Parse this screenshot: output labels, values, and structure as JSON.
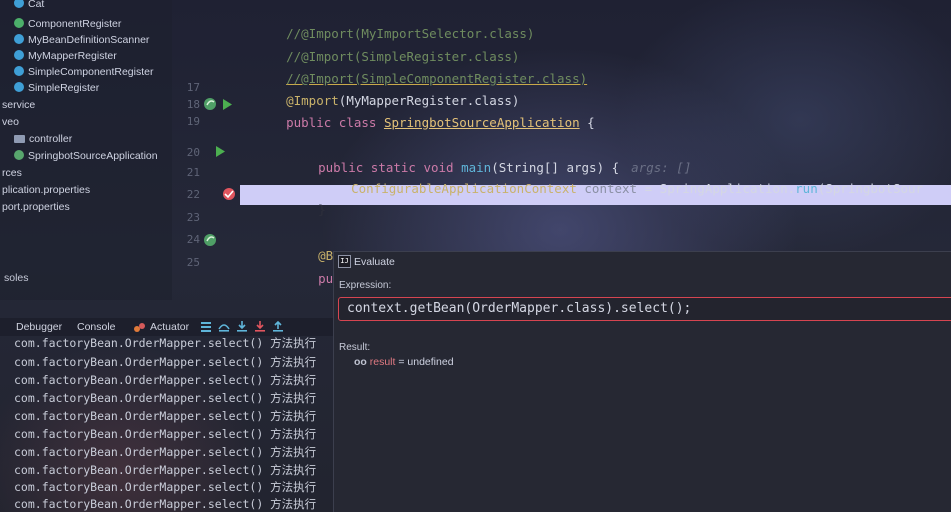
{
  "project_tree": {
    "items": [
      {
        "label": "Cat",
        "icon": "class-icon"
      },
      {
        "label": "ComponentRegister",
        "icon": "annotation-icon"
      },
      {
        "label": "MyBeanDefinitionScanner",
        "icon": "class-icon"
      },
      {
        "label": "MyMapperRegister",
        "icon": "class-icon"
      },
      {
        "label": "SimpleComponentRegister",
        "icon": "class-icon"
      },
      {
        "label": "SimpleRegister",
        "icon": "class-icon"
      },
      {
        "label": "service",
        "icon": ""
      },
      {
        "label": "veo",
        "icon": ""
      },
      {
        "label": "controller",
        "icon": "folder-icon"
      },
      {
        "label": "SpringbotSourceApplication",
        "icon": "spring-boot-icon"
      },
      {
        "label": "rces",
        "icon": ""
      },
      {
        "label": "plication.properties",
        "icon": ""
      },
      {
        "label": "port.properties",
        "icon": ""
      }
    ],
    "consoles_label": "soles"
  },
  "gutter": {
    "line_numbers": [
      "17",
      "18",
      "19",
      "20",
      "21",
      "22",
      "23",
      "24",
      "25"
    ]
  },
  "code": {
    "line1": "//@Import(MyImportSelector.class)",
    "line2": "//@Import(SimpleRegister.class)",
    "line3": "//@Import(SimpleComponentRegister.class)",
    "line4_ann": "@Import",
    "line4_rest": "(MyMapperRegister.class)",
    "line5_kw": "public class ",
    "line5_cls": "SpringbotSourceApplication",
    "line5_rest": " {",
    "line6_kw": "public static void ",
    "line6_fn": "main",
    "line6_rest": "(String[] args) {",
    "line6_hint": "args: []",
    "line7_a": "ConfigurableApplicationContext ",
    "line7_var": "context",
    "line7_b": " = SpringApplication.",
    "line7_fn": "run",
    "line7_c": "(SpringbotSour",
    "line8": "}",
    "line9": "@Bean",
    "line10": "publi"
  },
  "debugger": {
    "tabs": [
      "Debugger",
      "Console",
      "Actuator"
    ],
    "console_lines": [
      "com.factoryBean.OrderMapper.select() 方法执行",
      "com.factoryBean.OrderMapper.select() 方法执行",
      "com.factoryBean.OrderMapper.select() 方法执行",
      "com.factoryBean.OrderMapper.select() 方法执行",
      "com.factoryBean.OrderMapper.select() 方法执行",
      "com.factoryBean.OrderMapper.select() 方法执行",
      "com.factoryBean.OrderMapper.select() 方法执行",
      "com.factoryBean.OrderMapper.select() 方法执行",
      "com.factoryBean.OrderMapper.select() 方法执行",
      "com.factoryBean.OrderMapper.select() 方法执行"
    ]
  },
  "evaluate": {
    "title": "Evaluate",
    "logo_text": "IJ",
    "expression_label": "Expression:",
    "expression_value": "context.getBean(OrderMapper.class).select();",
    "result_label": "Result:",
    "result_icon": "oo",
    "result_name": "result",
    "result_value": " = undefined"
  },
  "colors": {
    "highlight_line": "#cfcdf7",
    "expression_border": "#d64551",
    "run_icon": "#4caf50",
    "breakpoint": "#e0555e"
  }
}
